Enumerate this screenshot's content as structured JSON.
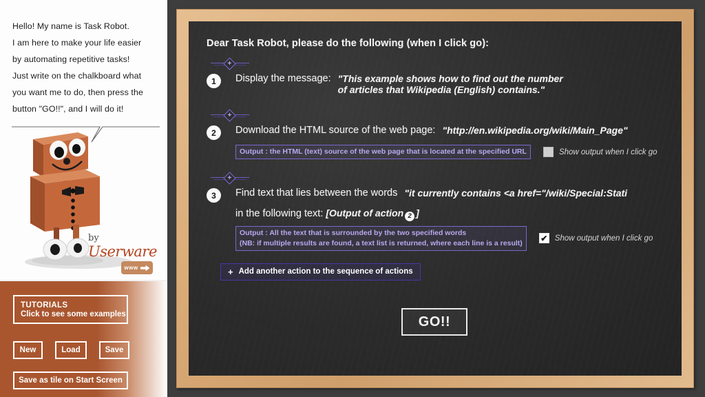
{
  "intro": {
    "lines": [
      "Hello! My name is Task Robot.",
      "I am here to make your life easier",
      "by automating repetitive tasks!",
      "Just write on the chalkboard what",
      "you want me to do, then press the",
      "button \"GO!!\", and I will do it!"
    ]
  },
  "branding": {
    "by_label": "by",
    "company": "Userware",
    "www_label": "www"
  },
  "side_panel": {
    "tutorials_title": "TUTORIALS",
    "tutorials_subtitle": "Click to see some examples",
    "new_label": "New",
    "load_label": "Load",
    "save_label": "Save",
    "save_tile_label": "Save as tile on Start Screen"
  },
  "board": {
    "title": "Dear Task Robot, please do the following (when I click go):",
    "add_action_plus": "+",
    "add_action_label": "Add another action to the sequence of actions",
    "go_label": "GO!!",
    "separator_glyph": "+",
    "actions": [
      {
        "number": "1",
        "label": "Display the message:",
        "value_line1": "\"This example shows how to find out the number",
        "value_line2": "of articles that Wikipedia (English) contains.\""
      },
      {
        "number": "2",
        "label": "Download the HTML source of the web page:",
        "value": "\"http://en.wikipedia.org/wiki/Main_Page\"",
        "output_line1": "Output : the HTML (text) source of the web page that is located at the specified URL",
        "checkbox_label": "Show output when I click go",
        "checkbox_checked": false,
        "check_glyph": ""
      },
      {
        "number": "3",
        "label": "Find text that lies between the words",
        "value": "\"it currently contains <a href=\"/wiki/Special:Stati",
        "sub_label": "in the following text:",
        "sub_value_open": "[Output of action",
        "sub_value_badge": "2",
        "sub_value_close": "]",
        "output_line1": "Output : All the text that is surrounded by the two specified words",
        "output_line2": "(NB: if multiple results are found, a text list is returned, where each line is a result)",
        "checkbox_label": "Show output when I click go",
        "checkbox_checked": true,
        "check_glyph": "✔"
      }
    ]
  },
  "colors": {
    "frame": "#d8a974",
    "board": "#2b2b2b",
    "accent_purple": "#7a68cf",
    "accent_indigo": "#4438a8",
    "panel_brown": "#a9562f",
    "signature_red": "#b4441f"
  }
}
